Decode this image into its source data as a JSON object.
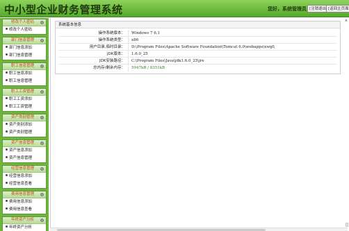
{
  "header": {
    "app_title": "中小型企业财务管理系统",
    "greeting": "您好，系统管理员",
    "logout_label": "[注销退出]",
    "back_label": "[返回主页面]"
  },
  "sidebar": {
    "sections": [
      {
        "title": "修改个人密码",
        "items": [
          "修改个人密码"
        ]
      },
      {
        "title": "部门信息管理",
        "items": [
          "部门信息添加",
          "部门信息管理"
        ]
      },
      {
        "title": "职工信息管理",
        "items": [
          "职工信息添加",
          "职工信息管理"
        ]
      },
      {
        "title": "职工工资管理",
        "items": [
          "职工工资添加",
          "职工工资管理"
        ]
      },
      {
        "title": "资产类别管理",
        "items": [
          "资产类别添加",
          "资产类别管理"
        ]
      },
      {
        "title": "资产信息管理",
        "items": [
          "资产信息添加",
          "资产信息管理"
        ]
      },
      {
        "title": "经营信息管理",
        "items": [
          "经营信息添加",
          "经营信息查看"
        ]
      },
      {
        "title": "费用信息管理",
        "items": [
          "费用信息添加",
          "费用信息查看"
        ]
      },
      {
        "title": "年终资产分析",
        "items": [
          "年终资产分析"
        ]
      }
    ]
  },
  "main": {
    "panel_title": "系统基本信息",
    "rows": [
      {
        "label": "操作系统版本：",
        "value": "Windows 7  6.1"
      },
      {
        "label": "操作系统类型：",
        "value": "x86"
      },
      {
        "label": "用户目录,临时目录：",
        "value": "D:\\Program Files\\Apache Software Foundation\\Tomcat 6.0\\webapps\\xwgl\\"
      },
      {
        "label": "JDK版本：",
        "value": "1.6.0_25"
      },
      {
        "label": "JDK安装路径：",
        "value": "C:\\Program Files\\Java\\jdk1.6.0_25\\jre"
      },
      {
        "label": "总内存/剩余内存：",
        "value": "5947kB / 8351kB"
      }
    ]
  },
  "colors": {
    "header_green": "#55a82a",
    "sidebar_green": "#6eb43f",
    "section_title": "#c24a12",
    "memory_value": "#2f7d1c"
  }
}
